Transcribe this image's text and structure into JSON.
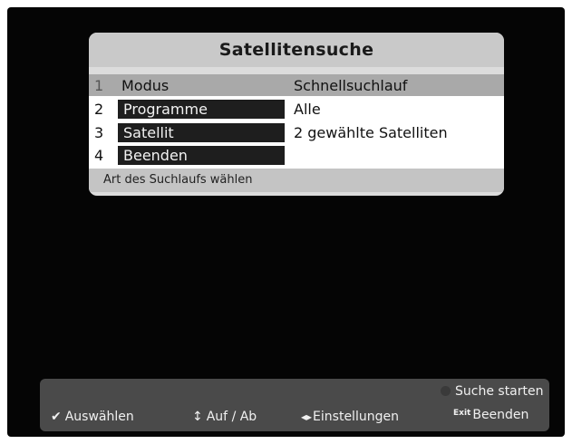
{
  "menu": {
    "title": "Satellitensuche",
    "rows": [
      {
        "num": "1",
        "label": "Modus",
        "value": "Schnellsuchlauf"
      },
      {
        "num": "2",
        "label": "Programme",
        "value": "Alle"
      },
      {
        "num": "3",
        "label": "Satellit",
        "value": "2 gewählte Satelliten"
      },
      {
        "num": "4",
        "label": "Beenden",
        "value": ""
      }
    ],
    "hint": "Art des Suchlaufs wählen"
  },
  "footer": {
    "start_search": "Suche starten",
    "select": "Auswählen",
    "up_down": "Auf / Ab",
    "settings": "Einstellungen",
    "exit": "Beenden",
    "exit_key": "Exit"
  },
  "icons": {
    "select": "checkmark-icon",
    "up_down": "up-down-arrow-icon",
    "settings": "left-right-arrow-icon",
    "start": "color-key-icon",
    "exit": "exit-key-icon"
  }
}
